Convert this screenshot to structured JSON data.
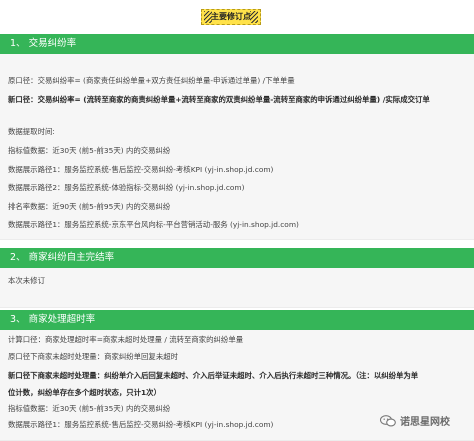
{
  "tag": {
    "label": "主要修订点"
  },
  "section1": {
    "title": "1、 交易纠纷率",
    "lines": [
      "原口径：交易纠纷率= (商家责任纠纷单量+双方责任纠纷单量-申诉通过单量) /下单单量",
      "新口径：交易纠纷率= (流转至商家的商责纠纷单量+流转至商家的双责纠纷单量-流转至商家的申诉通过纠纷单量) /实际成交订单",
      "数据提取时间:",
      "指标值数据：近30天 (前5-前35天) 内的交易纠纷",
      "数据展示路径1：服务监控系统-售后监控-交易纠纷-考核KPI (yj-in.shop.jd.com)",
      "数据展示路径2：服务监控系统-体验指标-交易纠纷 (yj-in.shop.jd.com)",
      "排名率数据：近90天 (前5-前95天) 内的交易纠纷",
      "数据展示路径1：服务监控系统-京东平台风向标-平台营销活动-服务 (yj-in.shop.jd.com)"
    ]
  },
  "section2": {
    "title": "2、 商家纠纷自主完结率",
    "lines": [
      "本次未修订"
    ]
  },
  "section3": {
    "title": "3、 商家处理超时率",
    "lines": [
      "计算口径：商家处理超时率=商家未超时处理量 / 流转至商家的纠纷单量",
      "原口径下商家未超时处理量：商家纠纷单回复未超时",
      "新口径下商家未超时处理量：纠纷单介入后回复未超时、介入后举证未超时、介入后执行未超时三种情况。（注：以纠纷单为单",
      "位计数，纠纷单存在多个超时状态，只计1次）",
      "指标值数据：近30天 (前5-前35天) 内的交易纠纷",
      "数据展示路径1：服务监控系统-售后监控-交易纠纷-考核KPI (yj-in.shop.jd.com)"
    ]
  },
  "watermark": {
    "label": "诺思星网校"
  }
}
